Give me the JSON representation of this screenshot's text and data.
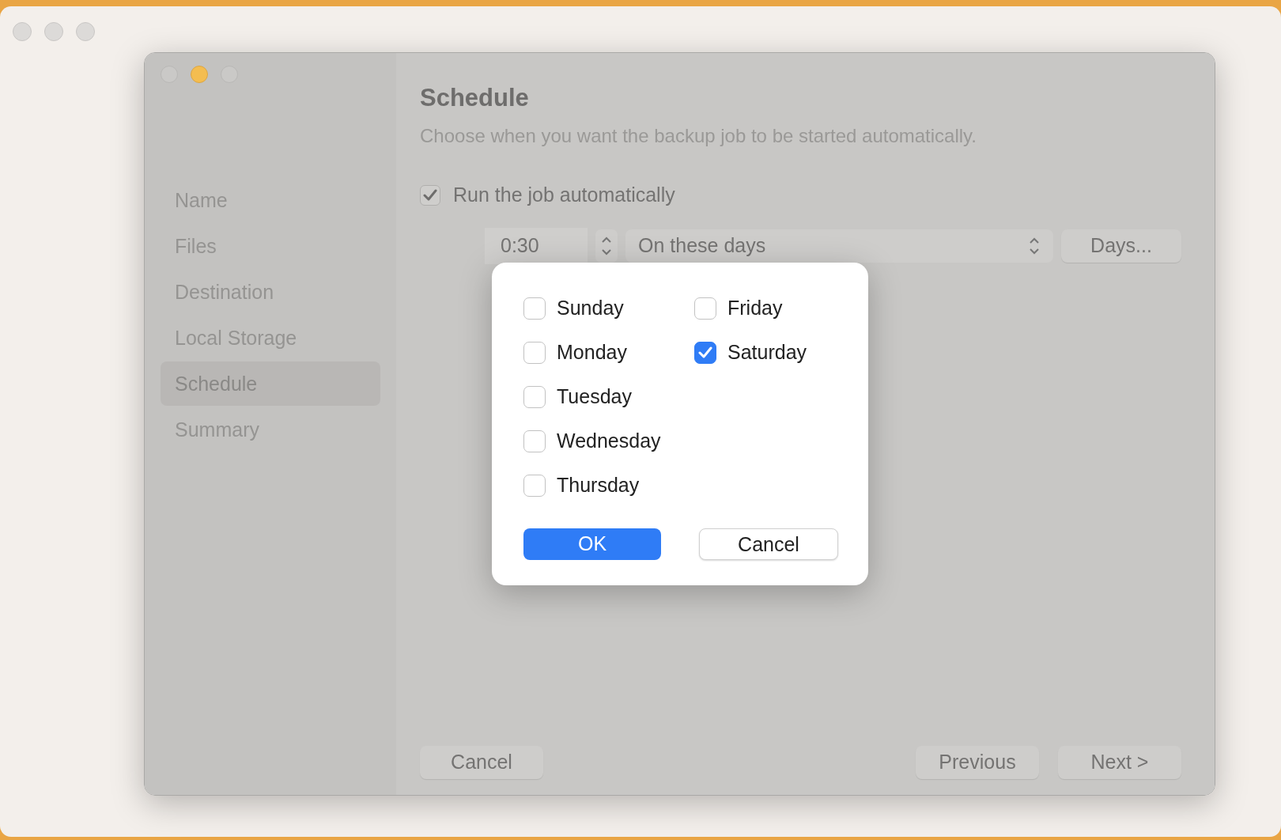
{
  "sidebar": {
    "items": [
      {
        "label": "Name",
        "selected": false
      },
      {
        "label": "Files",
        "selected": false
      },
      {
        "label": "Destination",
        "selected": false
      },
      {
        "label": "Local Storage",
        "selected": false
      },
      {
        "label": "Schedule",
        "selected": true
      },
      {
        "label": "Summary",
        "selected": false
      }
    ]
  },
  "page": {
    "title": "Schedule",
    "subtitle": "Choose when you want the backup job to be started automatically.",
    "run_automatically": {
      "label": "Run the job automatically",
      "checked": true
    },
    "time": {
      "value": "0:30"
    },
    "frequency": {
      "value": "On these days"
    },
    "days_button": "Days..."
  },
  "days_popover": {
    "days": [
      {
        "label": "Sunday",
        "checked": false
      },
      {
        "label": "Monday",
        "checked": false
      },
      {
        "label": "Tuesday",
        "checked": false
      },
      {
        "label": "Wednesday",
        "checked": false
      },
      {
        "label": "Thursday",
        "checked": false
      },
      {
        "label": "Friday",
        "checked": false
      },
      {
        "label": "Saturday",
        "checked": true
      }
    ],
    "ok_button": "OK",
    "cancel_button": "Cancel"
  },
  "footer": {
    "cancel_button": "Cancel",
    "previous_button": "Previous",
    "next_button": "Next >"
  }
}
